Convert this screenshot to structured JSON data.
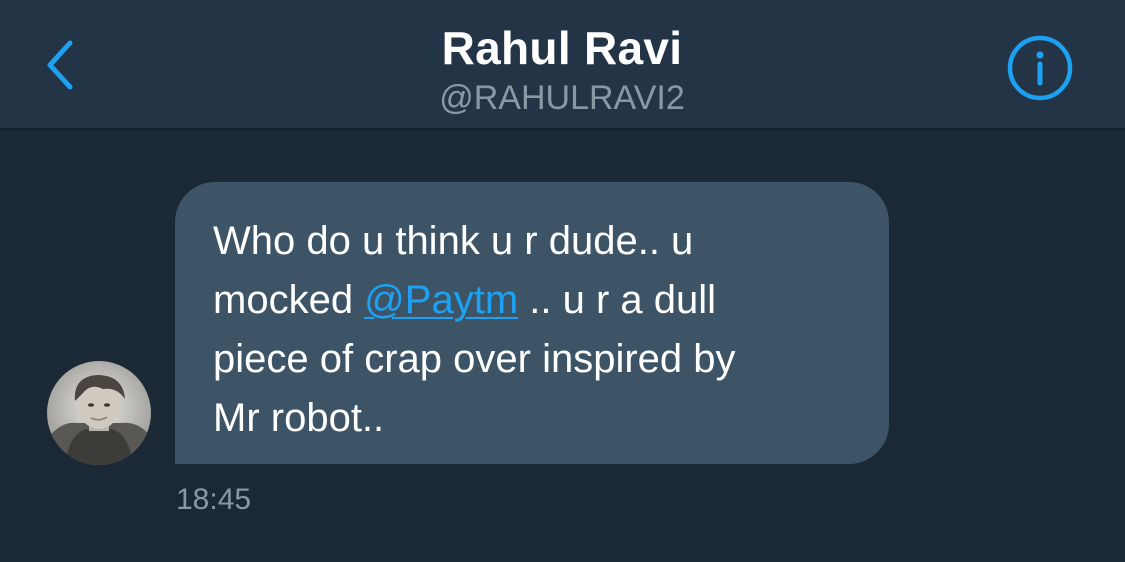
{
  "header": {
    "back_icon": "chevron-left-icon",
    "name": "Rahul Ravi",
    "handle": "@RAHULRAVI2",
    "info_icon": "info-circle-icon"
  },
  "message": {
    "line1": "Who do u think u r dude.. u",
    "line2_before": "mocked ",
    "mention": "@Paytm",
    "line2_after": " .. u r a dull",
    "line3": "piece of crap over inspired by",
    "line4": "Mr robot..",
    "timestamp": "18:45"
  },
  "colors": {
    "background": "#1b2836",
    "header": "#243447",
    "bubble": "#3d5466",
    "accent": "#1da1f2",
    "muted": "#8899a6"
  }
}
